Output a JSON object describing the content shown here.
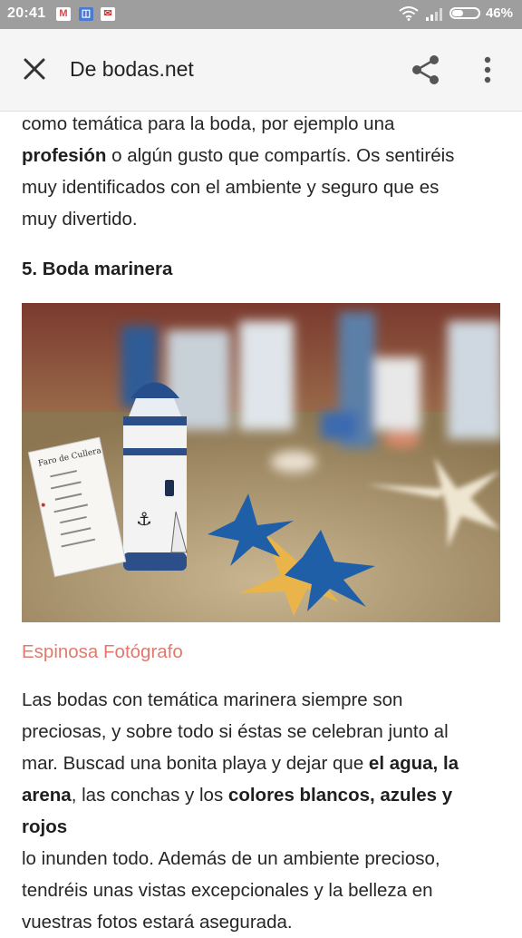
{
  "status_bar": {
    "time": "20:41",
    "battery_percent": "46%",
    "battery_level": 0.46
  },
  "toolbar": {
    "title": "De bodas.net"
  },
  "article": {
    "intro_line1": "como temática para la boda, por ejemplo una",
    "intro_bold": "profesión",
    "intro_line2_rest": " o algún gusto que compartís. Os sentiréis",
    "intro_line3": "muy identificados con el ambiente y seguro que es",
    "intro_line4": "muy divertido.",
    "section_heading": "5. Boda marinera",
    "photo_sign_label": "Faro de Cullera",
    "photo_credit": "Espinosa Fotógrafo",
    "body_line1": "Las bodas con temática marinera siempre son",
    "body_line2": "preciosas, y sobre todo si éstas se celebran junto al",
    "body_line3_a": "mar. Buscad una bonita playa y dejar que ",
    "body_line3_bold": "el agua, la",
    "body_line4_bold1": "arena",
    "body_line4_mid": ", las conchas y los ",
    "body_line4_bold2": "colores blancos, azules y rojos",
    "body_line5": "lo inunden todo. Además de un ambiente precioso,",
    "body_line6": "tendréis unas vistas excepcionales y la belleza en",
    "body_line7": "vuestras fotos estará asegurada."
  },
  "colors": {
    "credit": "#e07a6e",
    "status_bar": "#9e9e9e",
    "toolbar": "#f5f5f5"
  }
}
